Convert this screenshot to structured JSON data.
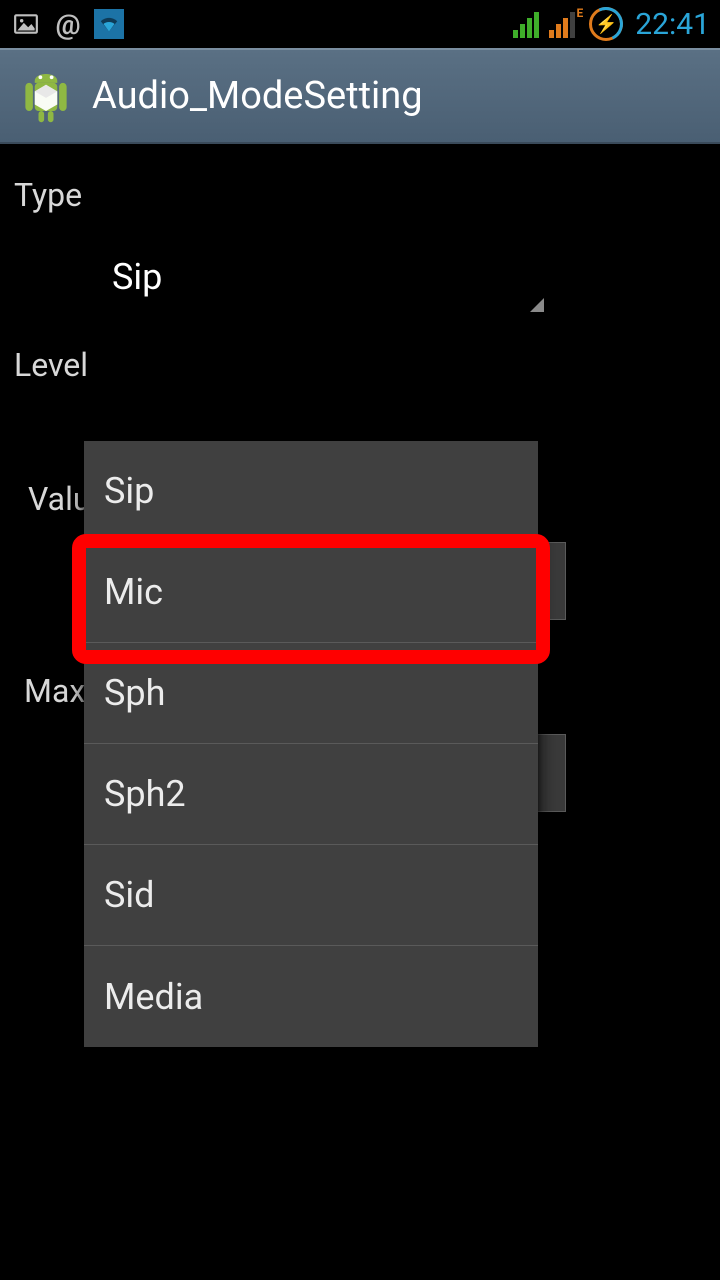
{
  "status": {
    "clock": "22:41",
    "edge_label": "E"
  },
  "actionbar": {
    "title": "Audio_ModeSetting"
  },
  "form": {
    "type_label": "Type",
    "level_label": "Level",
    "value_label": "Value",
    "maxvol_label": "Max Vol.",
    "selected_type": "Sip"
  },
  "dropdown": {
    "items": [
      "Sip",
      "Mic",
      "Sph",
      "Sph2",
      "Sid",
      "Media"
    ],
    "highlighted_index": 1
  }
}
